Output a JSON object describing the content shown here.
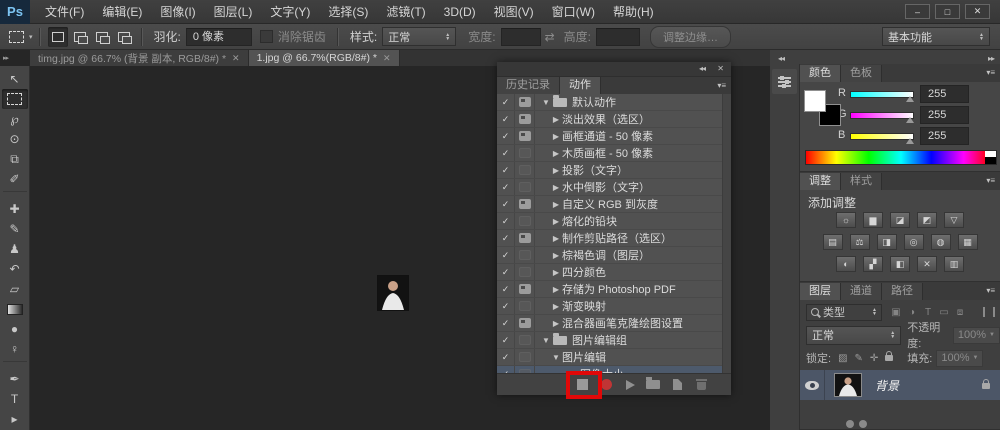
{
  "window": {
    "controls": [
      {
        "name": "minimize-button",
        "glyph": "–"
      },
      {
        "name": "maximize-button",
        "glyph": "□"
      },
      {
        "name": "close-button",
        "glyph": "✕"
      }
    ]
  },
  "menu_bar": {
    "logo": "Ps",
    "items": [
      "文件(F)",
      "编辑(E)",
      "图像(I)",
      "图层(L)",
      "文字(Y)",
      "选择(S)",
      "滤镜(T)",
      "3D(D)",
      "视图(V)",
      "窗口(W)",
      "帮助(H)"
    ]
  },
  "options_bar": {
    "feather_label": "羽化:",
    "feather_value": "0 像素",
    "antialias_label": "消除锯齿",
    "style_label": "样式:",
    "style_value": "正常",
    "width_label": "宽度:",
    "width_value": "",
    "height_label": "高度:",
    "height_value": "",
    "swap_icon": "⇄",
    "refine_edge_label": "调整边缘…",
    "workspace_label": "基本功能"
  },
  "document_tabs": [
    {
      "label": "timg.jpg @ 66.7% (背景 副本, RGB/8#) *",
      "active": false
    },
    {
      "label": "1.jpg @ 66.7%(RGB/8#) *",
      "active": true
    }
  ],
  "toolbar": {
    "tools": [
      {
        "name": "move-tool",
        "glyph": "↖"
      },
      {
        "name": "rectangular-marquee-tool",
        "special": "marquee",
        "active": true
      },
      {
        "name": "lasso-tool",
        "glyph": "℘"
      },
      {
        "name": "quick-selection-tool",
        "glyph": "⊙"
      },
      {
        "name": "crop-tool",
        "glyph": "⧉"
      },
      {
        "name": "eyedropper-tool",
        "glyph": "✐"
      },
      {
        "name": "spot-healing-brush-tool",
        "glyph": "✚",
        "gap": true
      },
      {
        "name": "brush-tool",
        "glyph": "✎"
      },
      {
        "name": "clone-stamp-tool",
        "glyph": "♟"
      },
      {
        "name": "history-brush-tool",
        "glyph": "↶"
      },
      {
        "name": "eraser-tool",
        "glyph": "▱"
      },
      {
        "name": "gradient-tool",
        "special": "gradient"
      },
      {
        "name": "blur-tool",
        "glyph": "●"
      },
      {
        "name": "dodge-tool",
        "glyph": "♀"
      },
      {
        "name": "pen-tool",
        "glyph": "✒",
        "gap": true
      },
      {
        "name": "type-tool",
        "glyph": "T"
      },
      {
        "name": "path-selection-tool",
        "glyph": "▸"
      }
    ]
  },
  "icons": {
    "check": "✓",
    "expanded": "▼",
    "collapsed": "▶",
    "collapse_left": "◂◂",
    "collapse_right": "▸▸",
    "close": "✕",
    "panel_menu": "▾≡"
  },
  "actions_panel": {
    "tabs": [
      {
        "label": "历史记录",
        "active": false
      },
      {
        "label": "动作",
        "active": true
      }
    ],
    "rows": [
      {
        "label": "默认动作",
        "type": "set",
        "expanded": true,
        "dialog": true,
        "indent": 0,
        "selected": false
      },
      {
        "label": "淡出效果（选区）",
        "type": "action",
        "expanded": false,
        "dialog": true,
        "indent": 1,
        "selected": false
      },
      {
        "label": "画框通道 - 50 像素",
        "type": "action",
        "expanded": false,
        "dialog": true,
        "indent": 1,
        "selected": false
      },
      {
        "label": "木质画框 - 50 像素",
        "type": "action",
        "expanded": false,
        "dialog": false,
        "indent": 1,
        "selected": false
      },
      {
        "label": "投影（文字）",
        "type": "action",
        "expanded": false,
        "dialog": false,
        "indent": 1,
        "selected": false
      },
      {
        "label": "水中倒影（文字）",
        "type": "action",
        "expanded": false,
        "dialog": false,
        "indent": 1,
        "selected": false
      },
      {
        "label": "自定义 RGB 到灰度",
        "type": "action",
        "expanded": false,
        "dialog": true,
        "indent": 1,
        "selected": false
      },
      {
        "label": "熔化的铅块",
        "type": "action",
        "expanded": false,
        "dialog": false,
        "indent": 1,
        "selected": false
      },
      {
        "label": "制作剪贴路径（选区）",
        "type": "action",
        "expanded": false,
        "dialog": true,
        "indent": 1,
        "selected": false
      },
      {
        "label": "棕褐色调（图层）",
        "type": "action",
        "expanded": false,
        "dialog": false,
        "indent": 1,
        "selected": false
      },
      {
        "label": "四分颜色",
        "type": "action",
        "expanded": false,
        "dialog": false,
        "indent": 1,
        "selected": false
      },
      {
        "label": "存储为 Photoshop PDF",
        "type": "action",
        "expanded": false,
        "dialog": true,
        "indent": 1,
        "selected": false
      },
      {
        "label": "渐变映射",
        "type": "action",
        "expanded": false,
        "dialog": false,
        "indent": 1,
        "selected": false
      },
      {
        "label": "混合器画笔克隆绘图设置",
        "type": "action",
        "expanded": false,
        "dialog": true,
        "indent": 1,
        "selected": false
      },
      {
        "label": "图片编辑组",
        "type": "set",
        "expanded": true,
        "dialog": false,
        "indent": 0,
        "selected": false
      },
      {
        "label": "图片编辑",
        "type": "action",
        "expanded": true,
        "dialog": false,
        "indent": 1,
        "selected": false
      },
      {
        "label": "图像大小",
        "type": "step",
        "expanded": false,
        "dialog": false,
        "indent": 2,
        "selected": true
      }
    ]
  },
  "color_panel": {
    "tabs": [
      {
        "label": "颜色",
        "active": true
      },
      {
        "label": "色板",
        "active": false
      }
    ],
    "channels": [
      {
        "label": "R",
        "value": "255",
        "track_from": "#00ffff"
      },
      {
        "label": "G",
        "value": "255",
        "track_from": "#ff00ff"
      },
      {
        "label": "B",
        "value": "255",
        "track_from": "#ffff00"
      }
    ],
    "foreground_color": "#ffffff",
    "background_color": "#000000"
  },
  "adjustments_panel": {
    "tabs": [
      {
        "label": "调整",
        "active": true
      },
      {
        "label": "样式",
        "active": false
      }
    ],
    "title": "添加调整",
    "icon_rows": [
      [
        {
          "name": "brightness-contrast-icon",
          "glyph": "☼"
        },
        {
          "name": "levels-icon",
          "glyph": "▆"
        },
        {
          "name": "curves-icon",
          "glyph": "◪"
        },
        {
          "name": "exposure-icon",
          "glyph": "◩"
        },
        {
          "name": "vibrance-icon",
          "glyph": "▽"
        }
      ],
      [
        {
          "name": "hue-saturation-icon",
          "glyph": "▤"
        },
        {
          "name": "color-balance-icon",
          "glyph": "⚖"
        },
        {
          "name": "black-white-icon",
          "glyph": "◨"
        },
        {
          "name": "photo-filter-icon",
          "glyph": "◎"
        },
        {
          "name": "channel-mixer-icon",
          "glyph": "◍"
        },
        {
          "name": "color-lookup-icon",
          "glyph": "▦"
        }
      ],
      [
        {
          "name": "invert-icon",
          "glyph": "◐"
        },
        {
          "name": "posterize-icon",
          "glyph": "▞"
        },
        {
          "name": "threshold-icon",
          "glyph": "◧"
        },
        {
          "name": "selective-color-icon",
          "glyph": "✕"
        },
        {
          "name": "gradient-map-icon",
          "glyph": "▥"
        }
      ]
    ]
  },
  "layers_panel": {
    "tabs": [
      {
        "label": "图层",
        "active": true
      },
      {
        "label": "通道",
        "active": false
      },
      {
        "label": "路径",
        "active": false
      }
    ],
    "filter_label": "类型",
    "filter_icons": [
      {
        "name": "filter-pixel-layers-icon",
        "glyph": "▣"
      },
      {
        "name": "filter-adjustment-layers-icon",
        "glyph": "◑"
      },
      {
        "name": "filter-type-layers-icon",
        "glyph": "T"
      },
      {
        "name": "filter-shape-layers-icon",
        "glyph": "▭"
      },
      {
        "name": "filter-smart-objects-icon",
        "glyph": "⧈"
      }
    ],
    "blend_mode": "正常",
    "opacity_label": "不透明度:",
    "opacity_value": "100%",
    "lock_label": "锁定:",
    "fill_label": "填充:",
    "fill_value": "100%",
    "layers": [
      {
        "name": "背景",
        "visible": true,
        "locked": true
      }
    ]
  }
}
